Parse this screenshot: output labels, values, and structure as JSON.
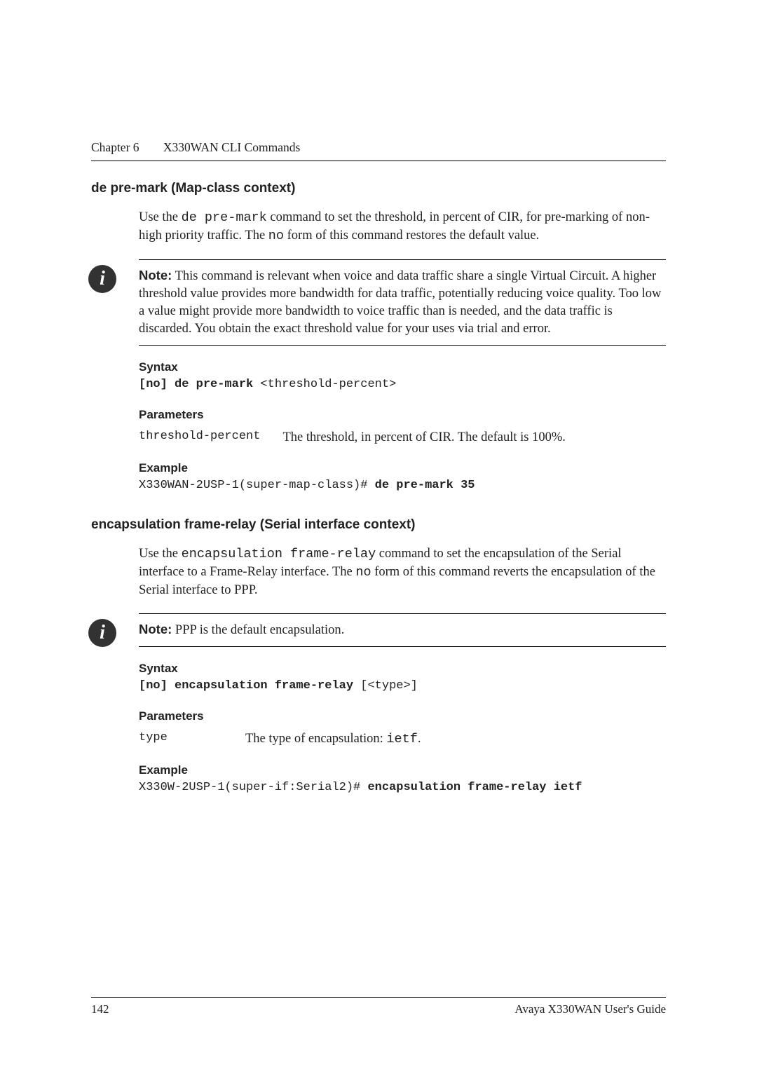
{
  "header": {
    "chapter": "Chapter 6",
    "title": "X330WAN CLI Commands"
  },
  "sec1": {
    "title": "de pre-mark (Map-class context)",
    "intro_a": "Use the ",
    "intro_cmd1": "de pre-mark",
    "intro_b": " command to set the threshold, in percent of CIR, for pre-marking of non-high priority traffic. The ",
    "intro_cmd2": "no",
    "intro_c": " form of this command restores the default value.",
    "note_label": "Note:",
    "note_text": "  This command is relevant when voice and data traffic share a single Virtual Circuit. A higher threshold value provides more bandwidth for data traffic, potentially reducing voice quality. Too low a value might provide more bandwidth to voice traffic than is needed, and the data traffic is discarded. You obtain the exact threshold value for your uses via trial and error.",
    "syntax_label": "Syntax",
    "syntax_bold": "[no] de pre-mark",
    "syntax_rest": " <threshold-percent>",
    "params_label": "Parameters",
    "param_name": "threshold-percent",
    "param_desc": "The threshold, in percent of CIR. The default is 100%.",
    "example_label": "Example",
    "example_prefix": "X330WAN-2USP-1(super-map-class)# ",
    "example_bold": "de pre-mark 35"
  },
  "sec2": {
    "title": "encapsulation frame-relay (Serial interface context)",
    "intro_a": "Use the ",
    "intro_cmd1": "encapsulation frame-relay",
    "intro_b": " command to set the encapsulation of the Serial interface to a Frame-Relay interface. The ",
    "intro_cmd2": "no",
    "intro_c": " form of this command reverts the encapsulation of the Serial interface to PPP.",
    "note_label": "Note:",
    "note_text": "  PPP is the default encapsulation.",
    "syntax_label": "Syntax",
    "syntax_bold": "[no] encapsulation frame-relay",
    "syntax_rest": " [<type>]",
    "params_label": "Parameters",
    "param_name": "type",
    "param_desc_a": "The type of encapsulation: ",
    "param_desc_mono": "ietf",
    "param_desc_b": ".",
    "example_label": "Example",
    "example_prefix": "X330W-2USP-1(super-if:Serial2)# ",
    "example_bold": "encapsulation frame-relay ietf"
  },
  "footer": {
    "page": "142",
    "guide": "Avaya X330WAN User's Guide"
  }
}
